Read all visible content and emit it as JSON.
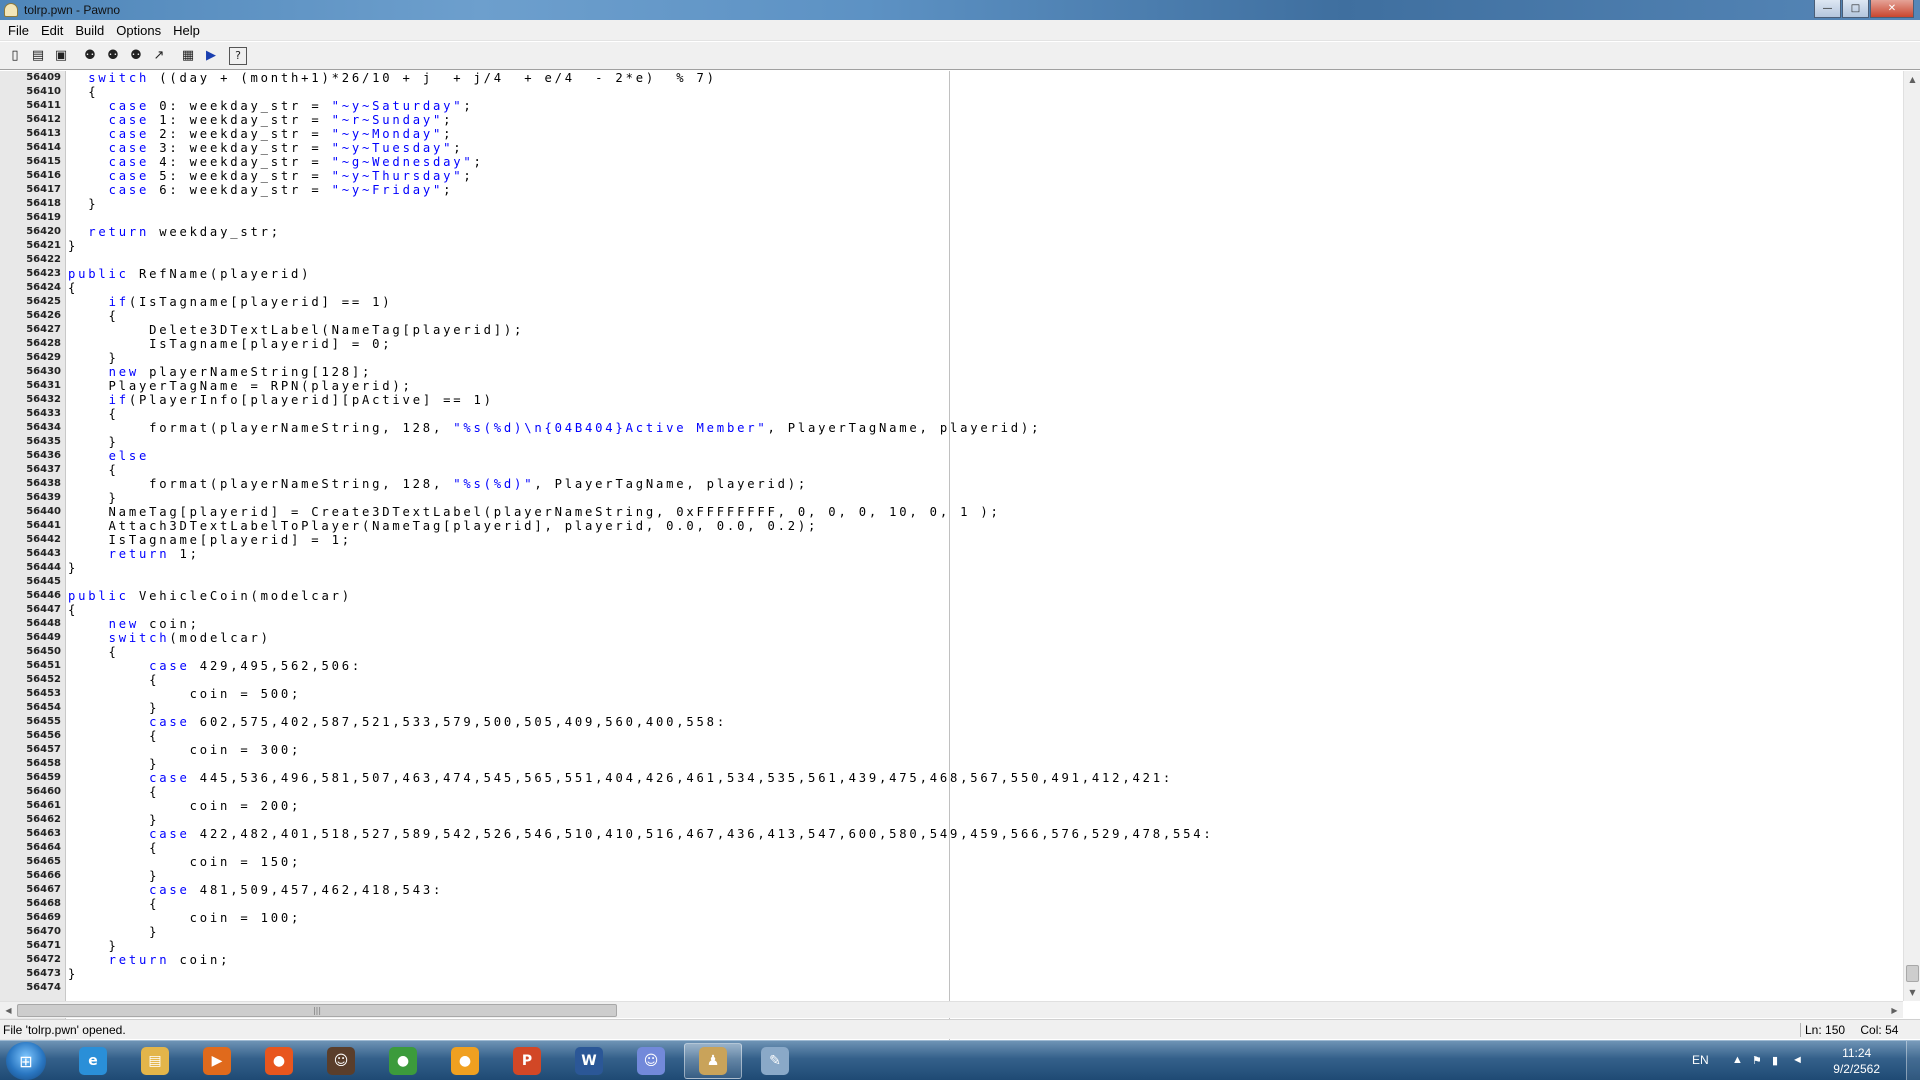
{
  "window": {
    "title": "tolrp.pwn - Pawno",
    "minimize_glyph": "—",
    "maximize_glyph": "□",
    "close_glyph": "✕"
  },
  "menu": {
    "items": [
      {
        "label": "File"
      },
      {
        "label": "Edit"
      },
      {
        "label": "Build"
      },
      {
        "label": "Options"
      },
      {
        "label": "Help"
      }
    ]
  },
  "toolbar": {
    "buttons": [
      {
        "icon": "new-file-icon",
        "glyph": "▯"
      },
      {
        "icon": "open-folder-icon",
        "glyph": "▤"
      },
      {
        "icon": "save-icon",
        "glyph": "▣"
      },
      {
        "icon": "find-icon",
        "glyph": "⚉"
      },
      {
        "icon": "find-next-icon",
        "glyph": "⚉"
      },
      {
        "icon": "replace-icon",
        "glyph": "⚉"
      },
      {
        "icon": "goto-line-icon",
        "glyph": "↗"
      },
      {
        "icon": "function-list-icon",
        "glyph": "▦"
      },
      {
        "icon": "compile-run-icon",
        "glyph": "▶"
      },
      {
        "icon": "help-icon",
        "glyph": "?"
      }
    ]
  },
  "editor": {
    "lines": [
      {
        "num": "56409",
        "text": "  switch ((day + (month+1)*26/10 + j  + j/4  + e/4  - 2*e)  % 7)"
      },
      {
        "num": "56410",
        "text": "  {"
      },
      {
        "num": "56411",
        "text": "    case 0: weekday_str = \"~y~Saturday\";"
      },
      {
        "num": "56412",
        "text": "    case 1: weekday_str = \"~r~Sunday\";"
      },
      {
        "num": "56413",
        "text": "    case 2: weekday_str = \"~y~Monday\";"
      },
      {
        "num": "56414",
        "text": "    case 3: weekday_str = \"~y~Tuesday\";"
      },
      {
        "num": "56415",
        "text": "    case 4: weekday_str = \"~g~Wednesday\";"
      },
      {
        "num": "56416",
        "text": "    case 5: weekday_str = \"~y~Thursday\";"
      },
      {
        "num": "56417",
        "text": "    case 6: weekday_str = \"~y~Friday\";"
      },
      {
        "num": "56418",
        "text": "  }"
      },
      {
        "num": "56419",
        "text": ""
      },
      {
        "num": "56420",
        "text": "  return weekday_str;"
      },
      {
        "num": "56421",
        "text": "}"
      },
      {
        "num": "56422",
        "text": ""
      },
      {
        "num": "56423",
        "text": "public RefName(playerid)"
      },
      {
        "num": "56424",
        "text": "{"
      },
      {
        "num": "56425",
        "text": "    if(IsTagname[playerid] == 1)"
      },
      {
        "num": "56426",
        "text": "    {"
      },
      {
        "num": "56427",
        "text": "        Delete3DTextLabel(NameTag[playerid]);"
      },
      {
        "num": "56428",
        "text": "        IsTagname[playerid] = 0;"
      },
      {
        "num": "56429",
        "text": "    }"
      },
      {
        "num": "56430",
        "text": "    new playerNameString[128];"
      },
      {
        "num": "56431",
        "text": "    PlayerTagName = RPN(playerid);"
      },
      {
        "num": "56432",
        "text": "    if(PlayerInfo[playerid][pActive] == 1)"
      },
      {
        "num": "56433",
        "text": "    {"
      },
      {
        "num": "56434",
        "text": "        format(playerNameString, 128, \"%s(%d)\\n{04B404}Active Member\", PlayerTagName, playerid);"
      },
      {
        "num": "56435",
        "text": "    }"
      },
      {
        "num": "56436",
        "text": "    else"
      },
      {
        "num": "56437",
        "text": "    {"
      },
      {
        "num": "56438",
        "text": "        format(playerNameString, 128, \"%s(%d)\", PlayerTagName, playerid);"
      },
      {
        "num": "56439",
        "text": "    }"
      },
      {
        "num": "56440",
        "text": "    NameTag[playerid] = Create3DTextLabel(playerNameString, 0xFFFFFFFF, 0, 0, 0, 10, 0, 1 );"
      },
      {
        "num": "56441",
        "text": "    Attach3DTextLabelToPlayer(NameTag[playerid], playerid, 0.0, 0.0, 0.2);"
      },
      {
        "num": "56442",
        "text": "    IsTagname[playerid] = 1;"
      },
      {
        "num": "56443",
        "text": "    return 1;"
      },
      {
        "num": "56444",
        "text": "}"
      },
      {
        "num": "56445",
        "text": ""
      },
      {
        "num": "56446",
        "text": "public VehicleCoin(modelcar)"
      },
      {
        "num": "56447",
        "text": "{"
      },
      {
        "num": "56448",
        "text": "    new coin;"
      },
      {
        "num": "56449",
        "text": "    switch(modelcar)"
      },
      {
        "num": "56450",
        "text": "    {"
      },
      {
        "num": "56451",
        "text": "        case 429,495,562,506:"
      },
      {
        "num": "56452",
        "text": "        {"
      },
      {
        "num": "56453",
        "text": "            coin = 500;"
      },
      {
        "num": "56454",
        "text": "        }"
      },
      {
        "num": "56455",
        "text": "        case 602,575,402,587,521,533,579,500,505,409,560,400,558:"
      },
      {
        "num": "56456",
        "text": "        {"
      },
      {
        "num": "56457",
        "text": "            coin = 300;"
      },
      {
        "num": "56458",
        "text": "        }"
      },
      {
        "num": "56459",
        "text": "        case 445,536,496,581,507,463,474,545,565,551,404,426,461,534,535,561,439,475,468,567,550,491,412,421:"
      },
      {
        "num": "56460",
        "text": "        {"
      },
      {
        "num": "56461",
        "text": "            coin = 200;"
      },
      {
        "num": "56462",
        "text": "        }"
      },
      {
        "num": "56463",
        "text": "        case 422,482,401,518,527,589,542,526,546,510,410,516,467,436,413,547,600,580,549,459,566,576,529,478,554:"
      },
      {
        "num": "56464",
        "text": "        {"
      },
      {
        "num": "56465",
        "text": "            coin = 150;"
      },
      {
        "num": "56466",
        "text": "        }"
      },
      {
        "num": "56467",
        "text": "        case 481,509,457,462,418,543:"
      },
      {
        "num": "56468",
        "text": "        {"
      },
      {
        "num": "56469",
        "text": "            coin = 100;"
      },
      {
        "num": "56470",
        "text": "        }"
      },
      {
        "num": "56471",
        "text": "    }"
      },
      {
        "num": "56472",
        "text": "    return coin;"
      },
      {
        "num": "56473",
        "text": "}"
      },
      {
        "num": "56474",
        "text": ""
      }
    ]
  },
  "scrollbars": {
    "up_glyph": "▲",
    "down_glyph": "▼",
    "left_glyph": "◀",
    "right_glyph": "▶",
    "grip_glyph": "|||"
  },
  "status": {
    "message": "File 'tolrp.pwn' opened.",
    "line": "Ln: 150",
    "col": "Col: 54"
  },
  "taskbar": {
    "start_glyph": "⊞",
    "apps": [
      {
        "name": "internet-explorer",
        "glyph": "e",
        "color": "#2a8fd8",
        "active": false
      },
      {
        "name": "file-explorer",
        "glyph": "▤",
        "color": "#e3b54a",
        "active": false
      },
      {
        "name": "media-player",
        "glyph": "▶",
        "color": "#e06a1c",
        "active": false
      },
      {
        "name": "firefox",
        "glyph": "●",
        "color": "#e8561e",
        "active": false
      },
      {
        "name": "game-app",
        "glyph": "☺",
        "color": "#5a3e2b",
        "active": false
      },
      {
        "name": "chrome",
        "glyph": "●",
        "color": "#3c9b3c",
        "active": false
      },
      {
        "name": "browser-app",
        "glyph": "●",
        "color": "#f0a020",
        "active": false
      },
      {
        "name": "powerpoint",
        "glyph": "P",
        "color": "#d24726",
        "active": false
      },
      {
        "name": "word",
        "glyph": "W",
        "color": "#2b5797",
        "active": false
      },
      {
        "name": "discord",
        "glyph": "☺",
        "color": "#7289da",
        "active": false
      },
      {
        "name": "pawno",
        "glyph": "♟",
        "color": "#c9a35a",
        "active": true
      },
      {
        "name": "paint",
        "glyph": "✎",
        "color": "#8aa9c8",
        "active": false
      }
    ],
    "tray": {
      "language": "EN",
      "time": "11:24",
      "date": "9/2/2562"
    }
  }
}
